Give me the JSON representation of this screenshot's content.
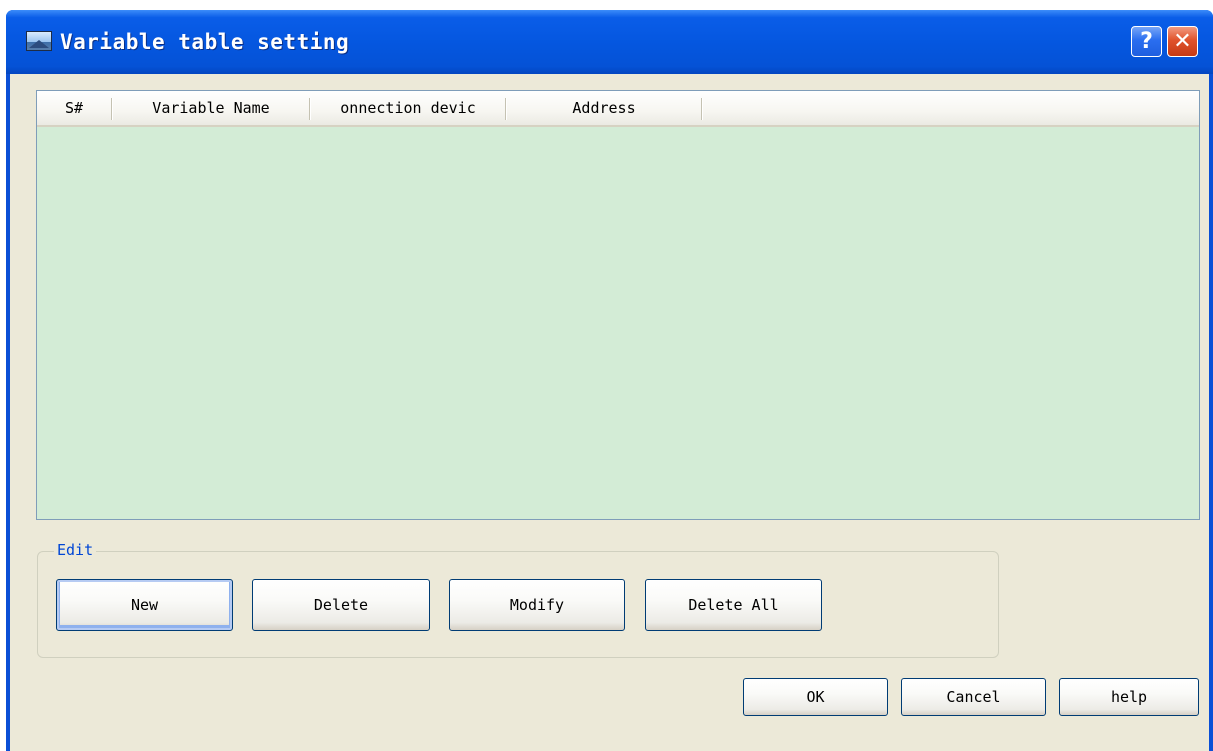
{
  "window": {
    "title": "Variable table setting",
    "help_glyph": "?",
    "close_glyph": "✕"
  },
  "list": {
    "columns": [
      "S#",
      "Variable Name",
      "onnection devic",
      "Address"
    ],
    "rows": []
  },
  "edit_group": {
    "label": "Edit",
    "buttons": {
      "new": "New",
      "delete": "Delete",
      "modify": "Modify",
      "delete_all": "Delete All"
    }
  },
  "footer": {
    "ok": "OK",
    "cancel": "Cancel",
    "help": "help"
  },
  "colors": {
    "title_bar": "#0557e0",
    "client_bg": "#ece9d8",
    "list_bg": "#d3ecd6",
    "group_label": "#0046d5"
  },
  "icons": {
    "title_icon": "window-picture-icon",
    "help": "help-question-icon",
    "close": "close-x-icon"
  }
}
